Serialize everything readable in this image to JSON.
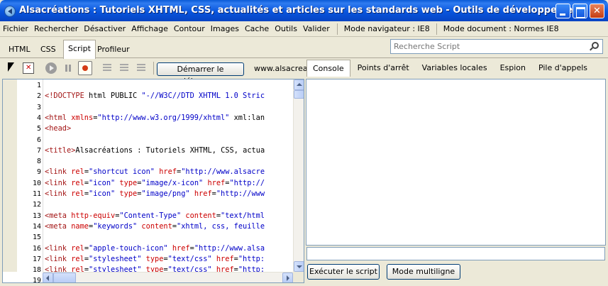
{
  "window": {
    "title": "Alsacréations : Tutoriels XHTML, CSS, actualités et articles sur les standards web - Outils de développement",
    "app_icon": "devtools-icon"
  },
  "menubar": {
    "items": [
      "Fichier",
      "Rechercher",
      "Désactiver",
      "Affichage",
      "Contour",
      "Images",
      "Cache",
      "Outils",
      "Valider"
    ],
    "browser_mode_label": "Mode navigateur :",
    "browser_mode_value": "IE8",
    "document_mode_label": "Mode document :",
    "document_mode_value": "Normes IE8"
  },
  "tabs": {
    "items": [
      "HTML",
      "CSS",
      "Script",
      "Profileur"
    ],
    "active": "Script"
  },
  "search": {
    "placeholder": "Recherche Script",
    "icon": "search-icon"
  },
  "toolbar": {
    "start_debug_label": "Démarrer le débogage",
    "script_source": "www.alsacrea",
    "console_tabs": [
      "Console",
      "Points d'arrêt",
      "Variables locales",
      "Espion",
      "Pile d'appels"
    ],
    "active_console_tab": "Console",
    "icons": [
      "select-element-icon",
      "clear-browser-cache-icon",
      "continue-icon",
      "break-all-icon",
      "break-on-error-icon",
      "step-into-icon",
      "step-over-icon",
      "step-out-icon"
    ]
  },
  "code": {
    "lines": [
      {
        "n": "1",
        "text": ""
      },
      {
        "n": "2",
        "text": "<!DOCTYPE html PUBLIC \"-//W3C//DTD XHTML 1.0 Stric"
      },
      {
        "n": "3",
        "text": ""
      },
      {
        "n": "4",
        "text": "<html xmlns=\"http://www.w3.org/1999/xhtml\" xml:lan"
      },
      {
        "n": "5",
        "text": "<head>"
      },
      {
        "n": "6",
        "text": ""
      },
      {
        "n": "7",
        "text": "<title>Alsacréations : Tutoriels XHTML, CSS, actua"
      },
      {
        "n": "8",
        "text": ""
      },
      {
        "n": "9",
        "text": "<link rel=\"shortcut icon\" href=\"http://www.alsacre"
      },
      {
        "n": "10",
        "text": "<link rel=\"icon\" type=\"image/x-icon\" href=\"http://"
      },
      {
        "n": "11",
        "text": "<link rel=\"icon\" type=\"image/png\" href=\"http://www"
      },
      {
        "n": "12",
        "text": ""
      },
      {
        "n": "13",
        "text": "<meta http-equiv=\"Content-Type\" content=\"text/html"
      },
      {
        "n": "14",
        "text": "<meta name=\"keywords\" content=\"xhtml, css, feuille"
      },
      {
        "n": "15",
        "text": ""
      },
      {
        "n": "16",
        "text": "<link rel=\"apple-touch-icon\" href=\"http://www.alsa"
      },
      {
        "n": "17",
        "text": "<link rel=\"stylesheet\" type=\"text/css\" href=\"http:"
      },
      {
        "n": "18",
        "text": "<link rel=\"stylesheet\" type=\"text/css\" href=\"http:"
      },
      {
        "n": "19",
        "text": ""
      }
    ]
  },
  "console": {
    "input_value": "",
    "run_script_label": "Exécuter le script",
    "multiline_label": "Mode multiligne"
  },
  "colors": {
    "titlebar": "#0855dd",
    "tag": "#a31515",
    "attribute": "#cc0000",
    "value": "#0000c8"
  }
}
